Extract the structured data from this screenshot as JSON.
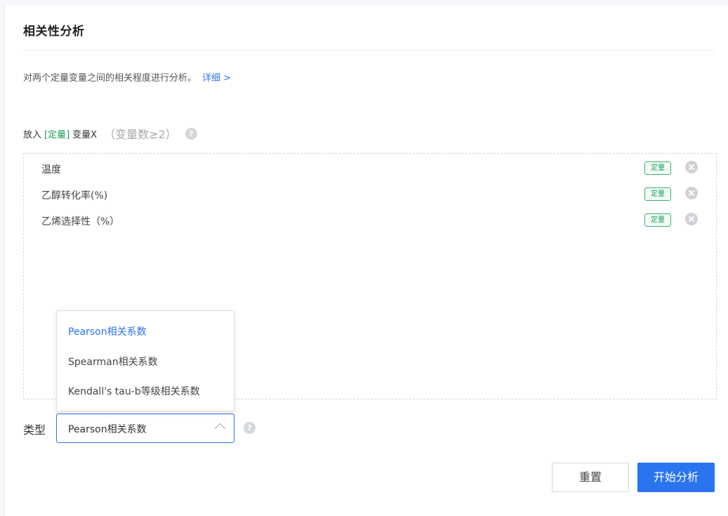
{
  "panel": {
    "title": "相关性分析",
    "description": "对两个定量变量之间的相关程度进行分析。",
    "detail_link": "详细 >"
  },
  "variable_field": {
    "label_prefix": "放入",
    "label_type": "[定量]",
    "label_suffix": "变量X",
    "hint": "（变量数≥2）",
    "help_icon": "question-circle-icon"
  },
  "variables": [
    {
      "name": "温度",
      "tag": "定量"
    },
    {
      "name": "乙醇转化率(%)",
      "tag": "定量"
    },
    {
      "name": "乙烯选择性（%）",
      "tag": "定量"
    }
  ],
  "type_select": {
    "label": "类型",
    "value": "Pearson相关系数",
    "options": [
      {
        "label": "Pearson相关系数",
        "selected": true
      },
      {
        "label": "Spearman相关系数",
        "selected": false
      },
      {
        "label": "Kendall's tau-b等级相关系数",
        "selected": false
      }
    ]
  },
  "actions": {
    "reset_label": "重置",
    "start_label": "开始分析"
  },
  "colors": {
    "accent": "#2a74f0",
    "tag_green": "#18a058"
  }
}
